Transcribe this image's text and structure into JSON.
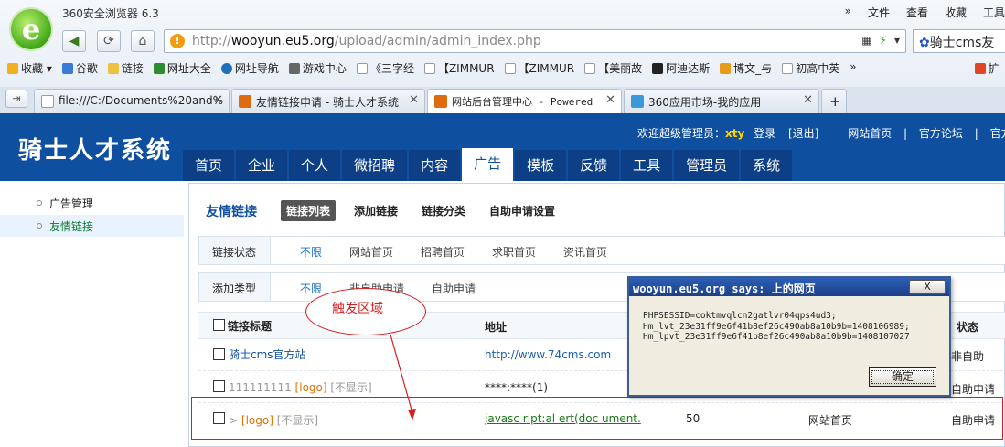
{
  "browser": {
    "app_title": "360安全浏览器 6.3",
    "menu": [
      "»",
      "文件",
      "查看",
      "收藏",
      "工具"
    ],
    "address_host": "wooyun.eu5.org",
    "address_prefix": "http://",
    "address_path": "/upload/admin/admin_index.php",
    "search_text": "骑士cms友",
    "bookmarks": [
      "收藏",
      "谷歌",
      "链接",
      "网址大全",
      "网址导航",
      "游戏中心",
      "《三字经",
      "【ZIMMUR",
      "【ZIMMUR",
      "【美丽故",
      "阿迪达斯",
      "博文_与",
      "初高中英",
      "»",
      "扩"
    ],
    "tabs": [
      {
        "label": "file:///C:/Documents%20and%",
        "active": false
      },
      {
        "label": "友情链接申请 - 骑士人才系统",
        "active": false
      },
      {
        "label": "网站后台管理中心 - Powered",
        "active": true
      },
      {
        "label": "360应用市场-我的应用",
        "active": false
      }
    ],
    "new_tab": "+"
  },
  "header": {
    "site_title": "骑士人才系统",
    "welcome": "欢迎超级管理员：",
    "username": "xty",
    "login": "登录",
    "logout": "[退出]",
    "site_home": "网站首页",
    "forum": "官方论坛",
    "official": "官方网",
    "nav": [
      "首页",
      "企业",
      "个人",
      "微招聘",
      "内容",
      "广告",
      "模板",
      "反馈",
      "工具",
      "管理员",
      "系统"
    ],
    "active_nav": "广告"
  },
  "sidebar": {
    "items": [
      "广告管理",
      "友情链接"
    ],
    "active": "友情链接"
  },
  "content": {
    "title": "友情链接",
    "pills": [
      "链接列表",
      "添加链接",
      "链接分类",
      "自助申请设置"
    ],
    "filter1": {
      "label": "链接状态",
      "options": [
        "不限",
        "网站首页",
        "招聘首页",
        "求职首页",
        "资讯首页"
      ]
    },
    "filter2": {
      "label": "添加类型",
      "options": [
        "不限",
        "非自助申请",
        "自助申请"
      ]
    },
    "columns": {
      "title": "链接标题",
      "url": "地址",
      "status": "状态"
    },
    "rows": [
      {
        "title": "骑士cms官方站",
        "url": "http://www.74cms.com",
        "status": "非自助"
      },
      {
        "title_num": "111111111",
        "logo": "[logo]",
        "hidden": "[不显示]",
        "url": "****:****(1)",
        "status": "自助申请"
      },
      {
        "arrow": ">",
        "logo": "[logo]",
        "hidden": "[不显示]",
        "url": "javasc ript:al ert(doc ument.",
        "order": "50",
        "position": "网站首页",
        "status": "自助申请"
      }
    ]
  },
  "annotation": {
    "label": "触发区域"
  },
  "dialog": {
    "title": "wooyun.eu5.org says: 上的网页",
    "close": "X",
    "message": "PHPSESSID=coktmvqlcn2gatlvr04qps4ud3;\nHm_lvt_23e31ff9e6f41b8ef26c490ab8a10b9b=1408106989;\nHm_lpvt_23e31ff9e6f41b8ef26c490ab8a10b9b=1408107027",
    "ok": "确定"
  },
  "colors": {
    "header_blue": "#0f4fa0",
    "accent_red": "#d71e1e",
    "link_active": "#1a70c8"
  }
}
